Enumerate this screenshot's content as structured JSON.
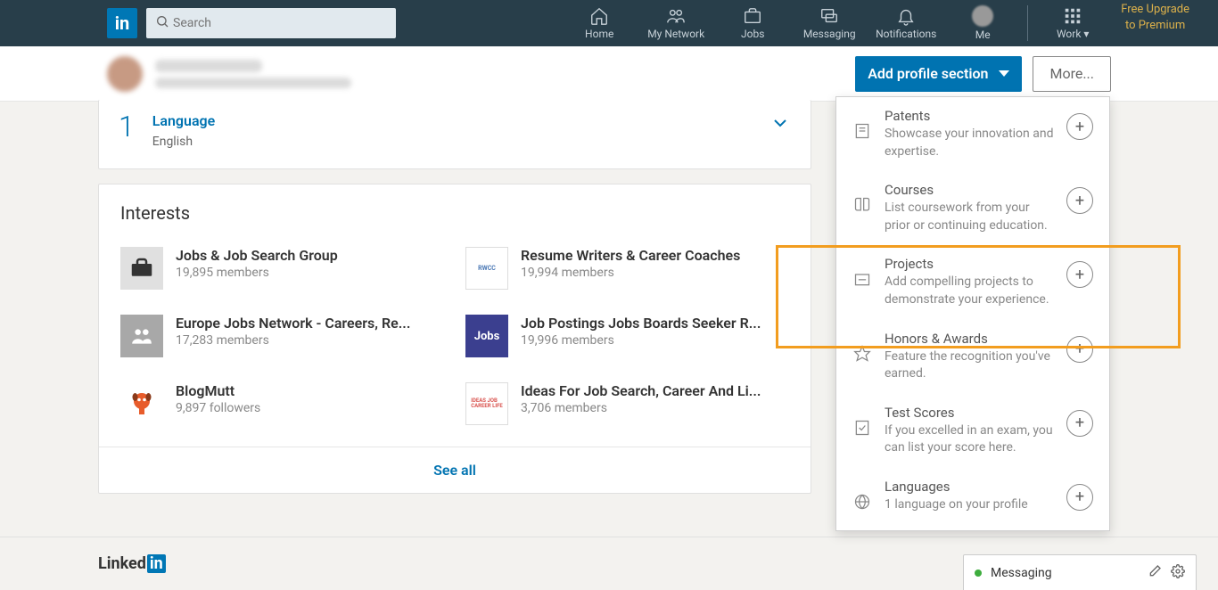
{
  "nav": {
    "search_placeholder": "Search",
    "items": [
      "Home",
      "My Network",
      "Jobs",
      "Messaging",
      "Notifications",
      "Me",
      "Work"
    ],
    "upgrade_line1": "Free Upgrade",
    "upgrade_line2": "to Premium"
  },
  "subbar": {
    "add_profile": "Add profile section",
    "more": "More..."
  },
  "language_card": {
    "count": "1",
    "title": "Language",
    "value": "English"
  },
  "interests": {
    "heading": "Interests",
    "see_all": "See all",
    "items": [
      {
        "name": "Jobs & Job Search Group",
        "meta": "19,895 members"
      },
      {
        "name": "Resume Writers & Career Coaches",
        "meta": "19,994 members"
      },
      {
        "name": "Europe Jobs Network - Careers, Re...",
        "meta": "17,283 members"
      },
      {
        "name": "Job Postings Jobs Boards Seeker R...",
        "meta": "19,996 members"
      },
      {
        "name": "BlogMutt",
        "meta": "9,897 followers"
      },
      {
        "name": "Ideas For Job Search, Career And Li...",
        "meta": "3,706 members"
      }
    ]
  },
  "dropdown": [
    {
      "title": "Patents",
      "desc": "Showcase your innovation and expertise."
    },
    {
      "title": "Courses",
      "desc": "List coursework from your prior or continuing education."
    },
    {
      "title": "Projects",
      "desc": "Add compelling projects to demonstrate your experience."
    },
    {
      "title": "Honors & Awards",
      "desc": "Feature the recognition you've earned."
    },
    {
      "title": "Test Scores",
      "desc": "If you excelled in an exam, you can list your score here."
    },
    {
      "title": "Languages",
      "desc": "1 language on your profile"
    }
  ],
  "footer": {
    "brand": "Linked"
  },
  "messaging": {
    "label": "Messaging"
  }
}
